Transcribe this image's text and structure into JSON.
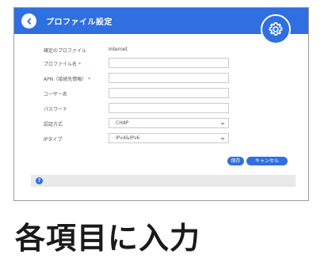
{
  "header": {
    "title": "プロファイル設定",
    "color": "#2f6fe0"
  },
  "form": {
    "current_profile": {
      "label": "確定のプロファイル",
      "value": "Internet"
    },
    "profile_name": {
      "label": "プロファイル名",
      "required_mark": "*",
      "value": ""
    },
    "apn": {
      "label": "APN（接続先情報）",
      "required_mark": "*",
      "value": ""
    },
    "username": {
      "label": "ユーザー名",
      "value": ""
    },
    "password": {
      "label": "パスワード",
      "value": ""
    },
    "auth_method": {
      "label": "認証方式",
      "value": "CHAP"
    },
    "ip_type": {
      "label": "IPタイプ",
      "value": "IPv4&IPv6"
    }
  },
  "buttons": {
    "save_label": "保存",
    "cancel_label": "キャンセル"
  },
  "info_bar": {
    "icon": "?"
  },
  "caption": "各項目に入力"
}
